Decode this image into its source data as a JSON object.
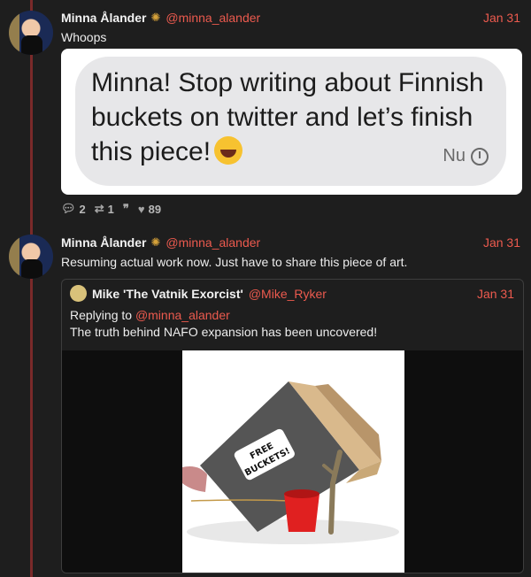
{
  "tweets": [
    {
      "author": "Minna Ålander",
      "handle": "@minna_alander",
      "date": "Jan 31",
      "text": "Whoops",
      "image": {
        "message": "Minna! Stop writing about Finnish buckets on twitter and let’s finish this piece!",
        "time": "Nu"
      },
      "stats": {
        "replies": "2",
        "retweets": "1",
        "likes": "89"
      }
    },
    {
      "author": "Minna Ålander",
      "handle": "@minna_alander",
      "date": "Jan 31",
      "text": "Resuming actual work now. Just have to share this piece of art.",
      "quote": {
        "author": "Mike 'The Vatnik Exorcist'",
        "handle": "@Mike_Ryker",
        "date": "Jan 31",
        "replying_prefix": "Replying to ",
        "replying_handle": "@minna_alander",
        "text": "The truth behind NAFO expansion has been uncovered!",
        "image": {
          "box_label_line1": "FREE",
          "box_label_line2": "BUCKETS!"
        }
      }
    }
  ],
  "colors": {
    "accent": "#ec5a4e",
    "background": "#1e1e1e",
    "verified": "#d6a23a"
  }
}
